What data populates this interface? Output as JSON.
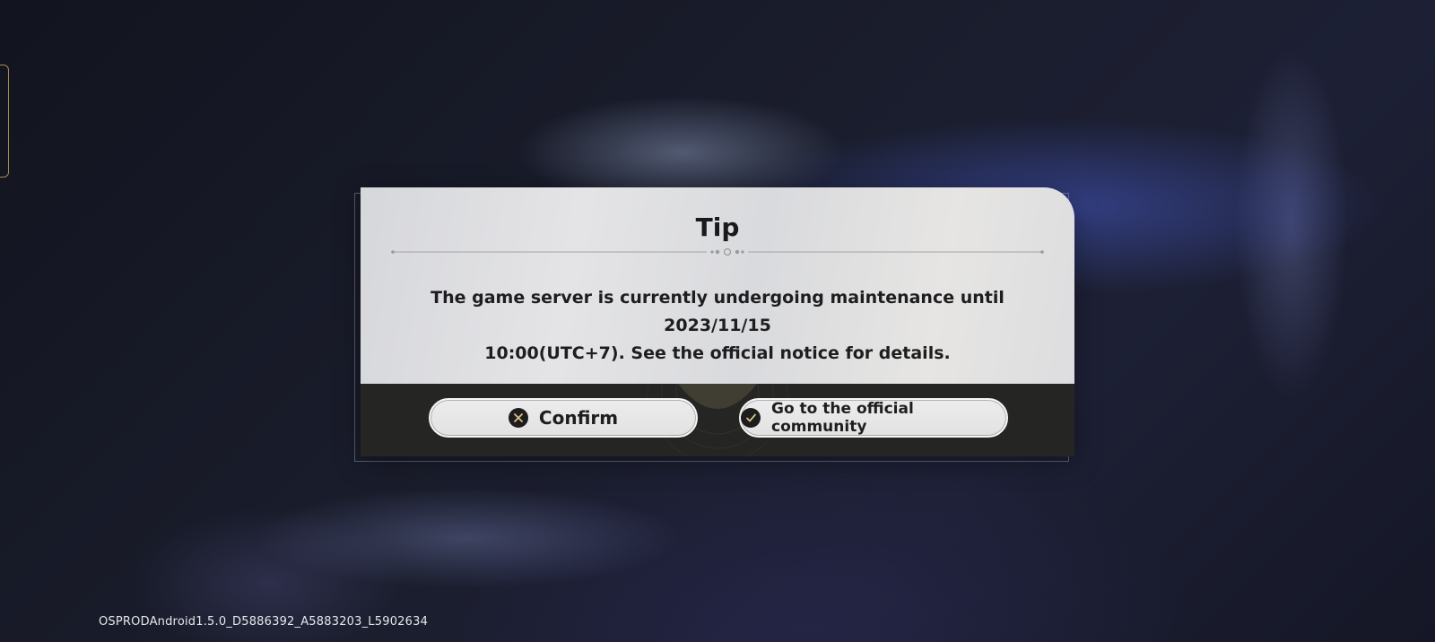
{
  "dialog": {
    "title": "Tip",
    "message_line1": "The game server is currently undergoing maintenance until 2023/11/15",
    "message_line2": "10:00(UTC+7). See the official notice for details.",
    "confirm_label": "Confirm",
    "community_label": "Go to the official community"
  },
  "footer": {
    "version": "OSPRODAndroid1.5.0_D5886392_A5883203_L5902634"
  },
  "icons": {
    "confirm": "close-circle-icon",
    "community": "check-circle-icon"
  },
  "colors": {
    "dialog_body": "#dcdcdf",
    "dialog_footer": "#252524",
    "button_bg": "#e8e8e8",
    "icon_bg": "#1d1d1d",
    "icon_accent": "#d8c08a",
    "left_tab_border": "#a88a4a"
  }
}
